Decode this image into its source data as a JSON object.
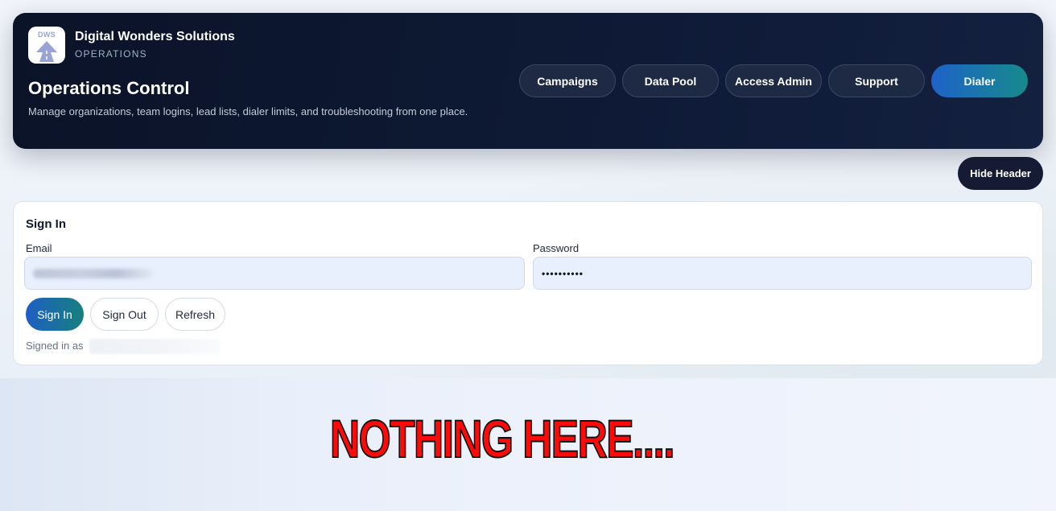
{
  "brand": {
    "logo_text": "DWS",
    "name": "Digital Wonders Solutions",
    "subtitle": "OPERATIONS"
  },
  "header": {
    "title": "Operations Control",
    "description": "Manage organizations, team logins, lead lists, dialer limits, and troubleshooting from one place.",
    "nav": [
      {
        "label": "Campaigns"
      },
      {
        "label": "Data Pool"
      },
      {
        "label": "Access Admin"
      },
      {
        "label": "Support"
      },
      {
        "label": "Dialer"
      }
    ],
    "hide_label": "Hide Header"
  },
  "signin": {
    "title": "Sign In",
    "email_label": "Email",
    "password_label": "Password",
    "password_value": "••••••••••",
    "buttons": {
      "sign_in": "Sign In",
      "sign_out": "Sign Out",
      "refresh": "Refresh"
    },
    "signed_in_prefix": "Signed in as"
  },
  "banner": {
    "text": "NOTHING HERE...."
  },
  "colors": {
    "header_bg": "#0e1a36",
    "accent_start": "#1e62c9",
    "accent_end": "#178a8c",
    "banner_red": "#ff0a0a"
  }
}
